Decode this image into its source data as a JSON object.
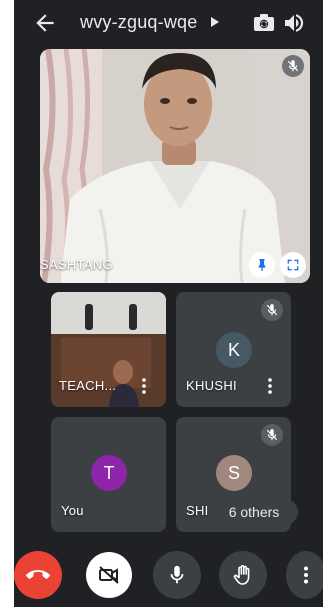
{
  "header": {
    "meeting_code": "wvy-zguq-wqe"
  },
  "main_tile": {
    "participant_name": "SASHTANG",
    "muted": true
  },
  "tiles": [
    {
      "name": "TEACH...",
      "video": true,
      "muted": false
    },
    {
      "name": "KHUSHI",
      "avatar_letter": "K",
      "avatar_color": "#455a64",
      "muted": true
    },
    {
      "name": "You",
      "avatar_letter": "T",
      "avatar_color": "#8e24aa",
      "muted": false
    },
    {
      "name": "SHI",
      "avatar_letter": "S",
      "avatar_color": "#a1887f",
      "muted": true
    }
  ],
  "others_chip": "6 others",
  "controls": {
    "end_call_color": "#ea4335",
    "camera_off_bg": "#ffffff"
  }
}
